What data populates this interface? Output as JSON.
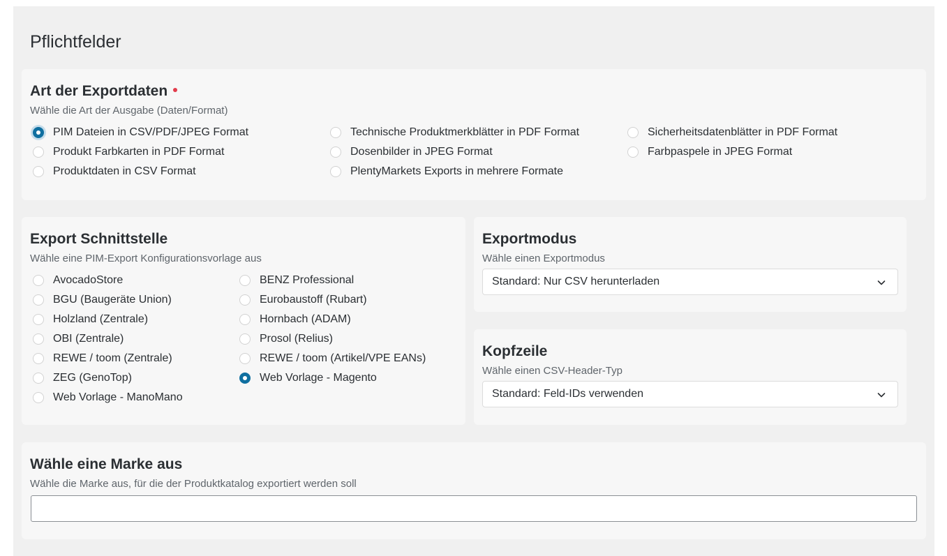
{
  "page": {
    "title": "Pflichtfelder"
  },
  "export_type": {
    "title": "Art der Exportdaten",
    "subtitle": "Wähle die Art der Ausgabe (Daten/Format)",
    "options": [
      {
        "label": "PIM Dateien in CSV/PDF/JPEG Format",
        "checked": true
      },
      {
        "label": "Produkt Farbkarten in PDF Format",
        "checked": false
      },
      {
        "label": "Produktdaten in CSV Format",
        "checked": false
      },
      {
        "label": "Technische Produktmerkblätter in PDF Format",
        "checked": false
      },
      {
        "label": "Dosenbilder in JPEG Format",
        "checked": false
      },
      {
        "label": "PlentyMarkets Exports in mehrere Formate",
        "checked": false
      },
      {
        "label": "Sicherheitsdatenblätter in PDF Format",
        "checked": false
      },
      {
        "label": "Farbpaspele in JPEG Format",
        "checked": false
      }
    ]
  },
  "interface": {
    "title": "Export Schnittstelle",
    "subtitle": "Wähle eine PIM-Export Konfigurationsvorlage aus",
    "options": [
      {
        "label": "AvocadoStore",
        "checked": false
      },
      {
        "label": "BGU (Baugeräte Union)",
        "checked": false
      },
      {
        "label": "Holzland (Zentrale)",
        "checked": false
      },
      {
        "label": "OBI (Zentrale)",
        "checked": false
      },
      {
        "label": "REWE / toom (Zentrale)",
        "checked": false
      },
      {
        "label": "ZEG (GenoTop)",
        "checked": false
      },
      {
        "label": "Web Vorlage - ManoMano",
        "checked": false
      },
      {
        "label": "BENZ Professional",
        "checked": false
      },
      {
        "label": "Eurobaustoff (Rubart)",
        "checked": false
      },
      {
        "label": "Hornbach (ADAM)",
        "checked": false
      },
      {
        "label": "Prosol (Relius)",
        "checked": false
      },
      {
        "label": "REWE / toom (Artikel/VPE EANs)",
        "checked": false
      },
      {
        "label": "Web Vorlage - Magento",
        "checked": true
      }
    ]
  },
  "export_mode": {
    "title": "Exportmodus",
    "subtitle": "Wähle einen Exportmodus",
    "selected": "Standard: Nur CSV herunterladen"
  },
  "header_row": {
    "title": "Kopfzeile",
    "subtitle": "Wähle einen CSV-Header-Typ",
    "selected": "Standard: Feld-IDs verwenden"
  },
  "brand": {
    "title": "Wähle eine Marke aus",
    "subtitle": "Wähle die Marke aus, für die der Produktkatalog exportiert werden soll",
    "value": ""
  },
  "colors": {
    "accent": "#0f6fa0",
    "required_dot": "#e23b4b",
    "panel_bg": "#f0f0f0",
    "card_bg": "#f7f7f7"
  },
  "icons": {
    "select_arrow": "chevron-down-icon",
    "required": "required-dot-icon"
  }
}
